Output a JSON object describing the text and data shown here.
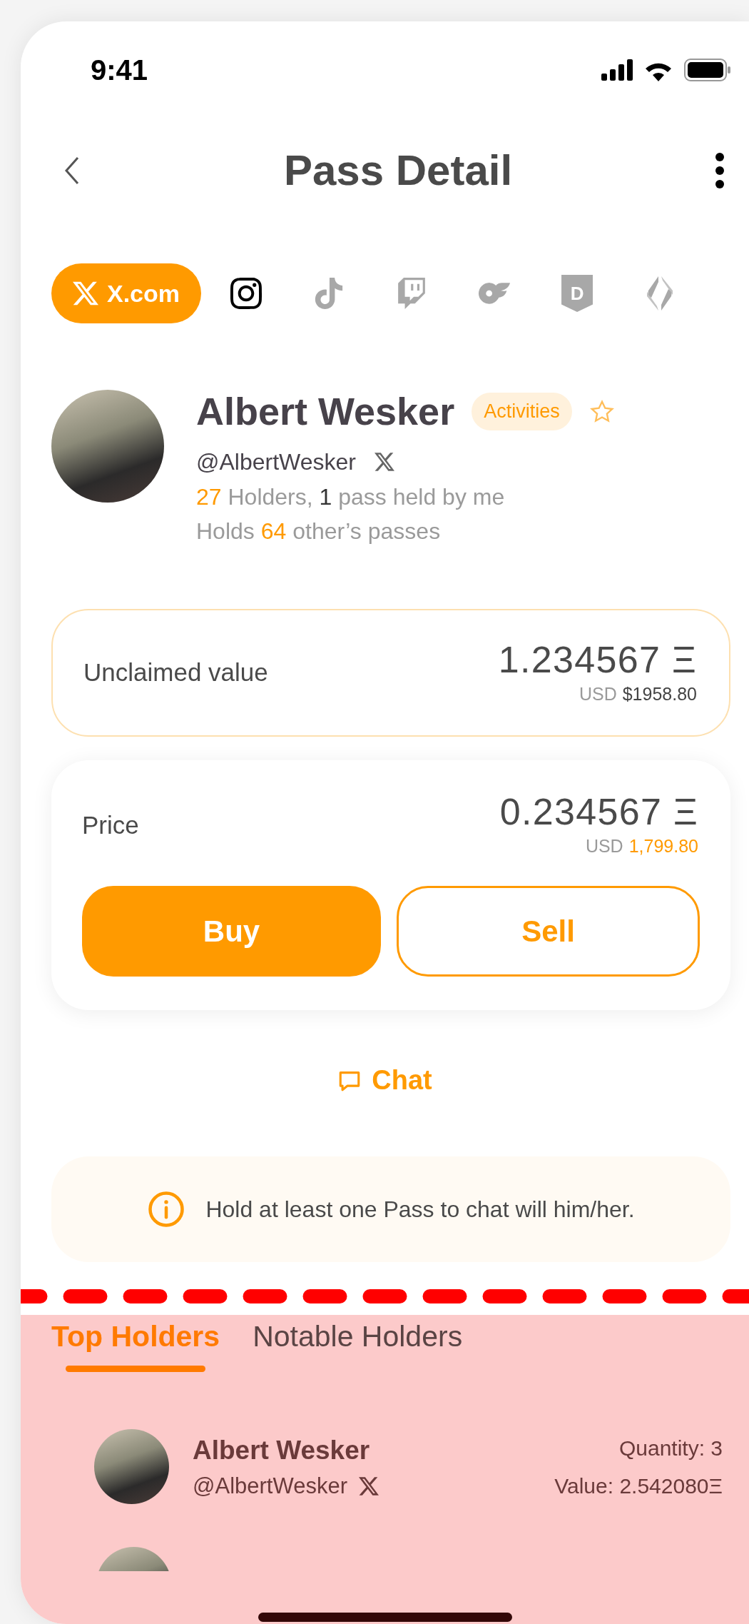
{
  "status_bar": {
    "time": "9:41"
  },
  "header": {
    "title": "Pass Detail"
  },
  "platforms": [
    {
      "kind": "x",
      "label": "X.com",
      "selected": true,
      "linked": true
    },
    {
      "kind": "instagram",
      "selected": false,
      "linked": true
    },
    {
      "kind": "tiktok",
      "selected": false,
      "linked": false
    },
    {
      "kind": "twitch",
      "selected": false,
      "linked": false
    },
    {
      "kind": "onlyfans",
      "selected": false,
      "linked": false
    },
    {
      "kind": "badge",
      "label": "D",
      "selected": false,
      "linked": false
    },
    {
      "kind": "ens",
      "selected": false,
      "linked": false
    }
  ],
  "profile": {
    "name": "Albert Wesker",
    "badge": "Activities",
    "favorite": false,
    "handle": "@AlbertWesker",
    "stats": [
      [
        {
          "text": "27",
          "color": "#ff9a00"
        },
        {
          "text": " Holders, ",
          "color": "#9a9a9a"
        },
        {
          "text": "1",
          "color": "#333333"
        },
        {
          "text": " pass held by me",
          "color": "#9a9a9a"
        }
      ],
      [
        {
          "text": "Holds ",
          "color": "#9a9a9a"
        },
        {
          "text": "64",
          "color": "#ff9a00"
        },
        {
          "text": " other’s passes",
          "color": "#9a9a9a"
        }
      ]
    ]
  },
  "unclaimed": {
    "label": "Unclaimed value",
    "amount": "1.234567 Ξ",
    "currency": "USD",
    "usd": "$1958.80"
  },
  "price": {
    "label": "Price",
    "amount": "0.234567 Ξ",
    "currency": "USD",
    "usd": "1,799.80"
  },
  "actions": [
    {
      "kind": "primary",
      "label": "Buy"
    },
    {
      "kind": "outline",
      "label": "Sell"
    }
  ],
  "chat": {
    "label": "Chat"
  },
  "notice": {
    "text": "Hold at least one Pass to chat will him/her."
  },
  "holder_tabs": [
    {
      "label": "Top Holders",
      "selected": true
    },
    {
      "label": "Notable Holders",
      "selected": false
    }
  ],
  "holders": [
    {
      "name": "Albert Wesker",
      "handle": "@AlbertWesker",
      "quantity": "Quantity: 3",
      "value": "Value: 2.542080Ξ"
    }
  ]
}
